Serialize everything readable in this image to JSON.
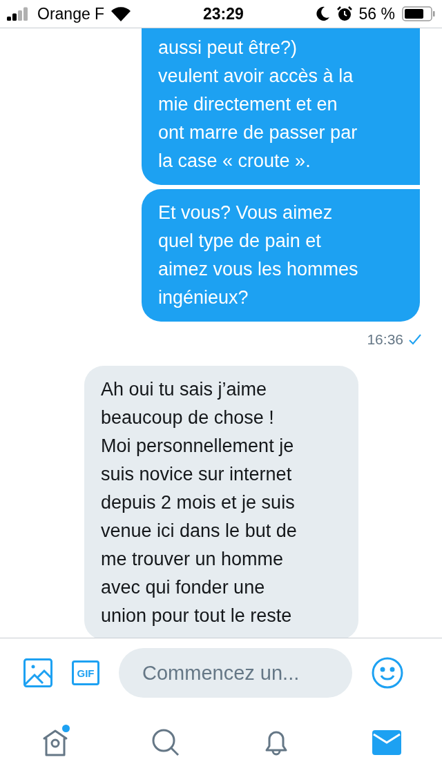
{
  "status_bar": {
    "carrier": "Orange F",
    "time": "23:29",
    "battery_percent": "56 %"
  },
  "messages": [
    {
      "kind": "sent",
      "text": "aussi peut être?)\nveulent avoir accès à la\nmie directement et en\nont marre de passer par\nla case « croute »."
    },
    {
      "kind": "sent",
      "text": "Et vous? Vous aimez\nquel type de pain et\naimez vous les hommes\ningénieux?",
      "time": "16:36",
      "read": true
    },
    {
      "kind": "received",
      "text": "Ah oui tu sais j’aime\nbeaucoup de chose !\nMoi personnellement je\nsuis novice sur internet\ndepuis 2 mois et je suis\nvenue ici dans le but de\nme trouver un homme\navec qui fonder une\nunion pour tout le reste"
    }
  ],
  "composer": {
    "gif_label": "GIF",
    "placeholder": "Commencez un..."
  },
  "tab_bar": [
    {
      "kind": "home",
      "selected": false,
      "badge": true
    },
    {
      "kind": "search",
      "selected": false,
      "badge": false
    },
    {
      "kind": "notifications",
      "selected": false,
      "badge": false
    },
    {
      "kind": "messages",
      "selected": true,
      "badge": false
    }
  ]
}
